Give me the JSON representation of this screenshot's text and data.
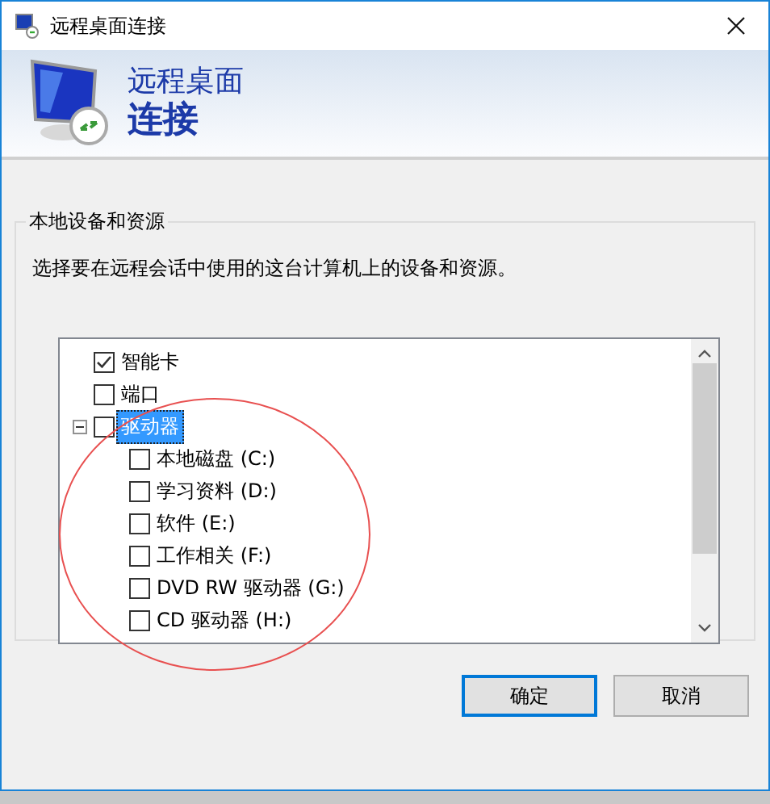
{
  "window": {
    "title": "远程桌面连接"
  },
  "header": {
    "line1": "远程桌面",
    "line2": "连接"
  },
  "group": {
    "title": "本地设备和资源",
    "description": "选择要在远程会话中使用的这台计算机上的设备和资源。"
  },
  "tree": [
    {
      "label": "智能卡",
      "checked": true,
      "selected": false
    },
    {
      "label": "端口",
      "checked": false,
      "selected": false
    },
    {
      "label": "驱动器",
      "checked": false,
      "selected": true,
      "expanded": true,
      "children": [
        {
          "label": "本地磁盘 (C:)",
          "checked": false,
          "selected": false
        },
        {
          "label": "学习资料 (D:)",
          "checked": false,
          "selected": false
        },
        {
          "label": "软件 (E:)",
          "checked": false,
          "selected": false
        },
        {
          "label": "工作相关 (F:)",
          "checked": false,
          "selected": false
        },
        {
          "label": "DVD RW 驱动器 (G:)",
          "checked": false,
          "selected": false
        },
        {
          "label": "CD 驱动器 (H:)",
          "checked": false,
          "selected": false
        }
      ]
    }
  ],
  "buttons": [
    {
      "label": "确定",
      "default": true
    },
    {
      "label": "取消",
      "default": false
    }
  ]
}
